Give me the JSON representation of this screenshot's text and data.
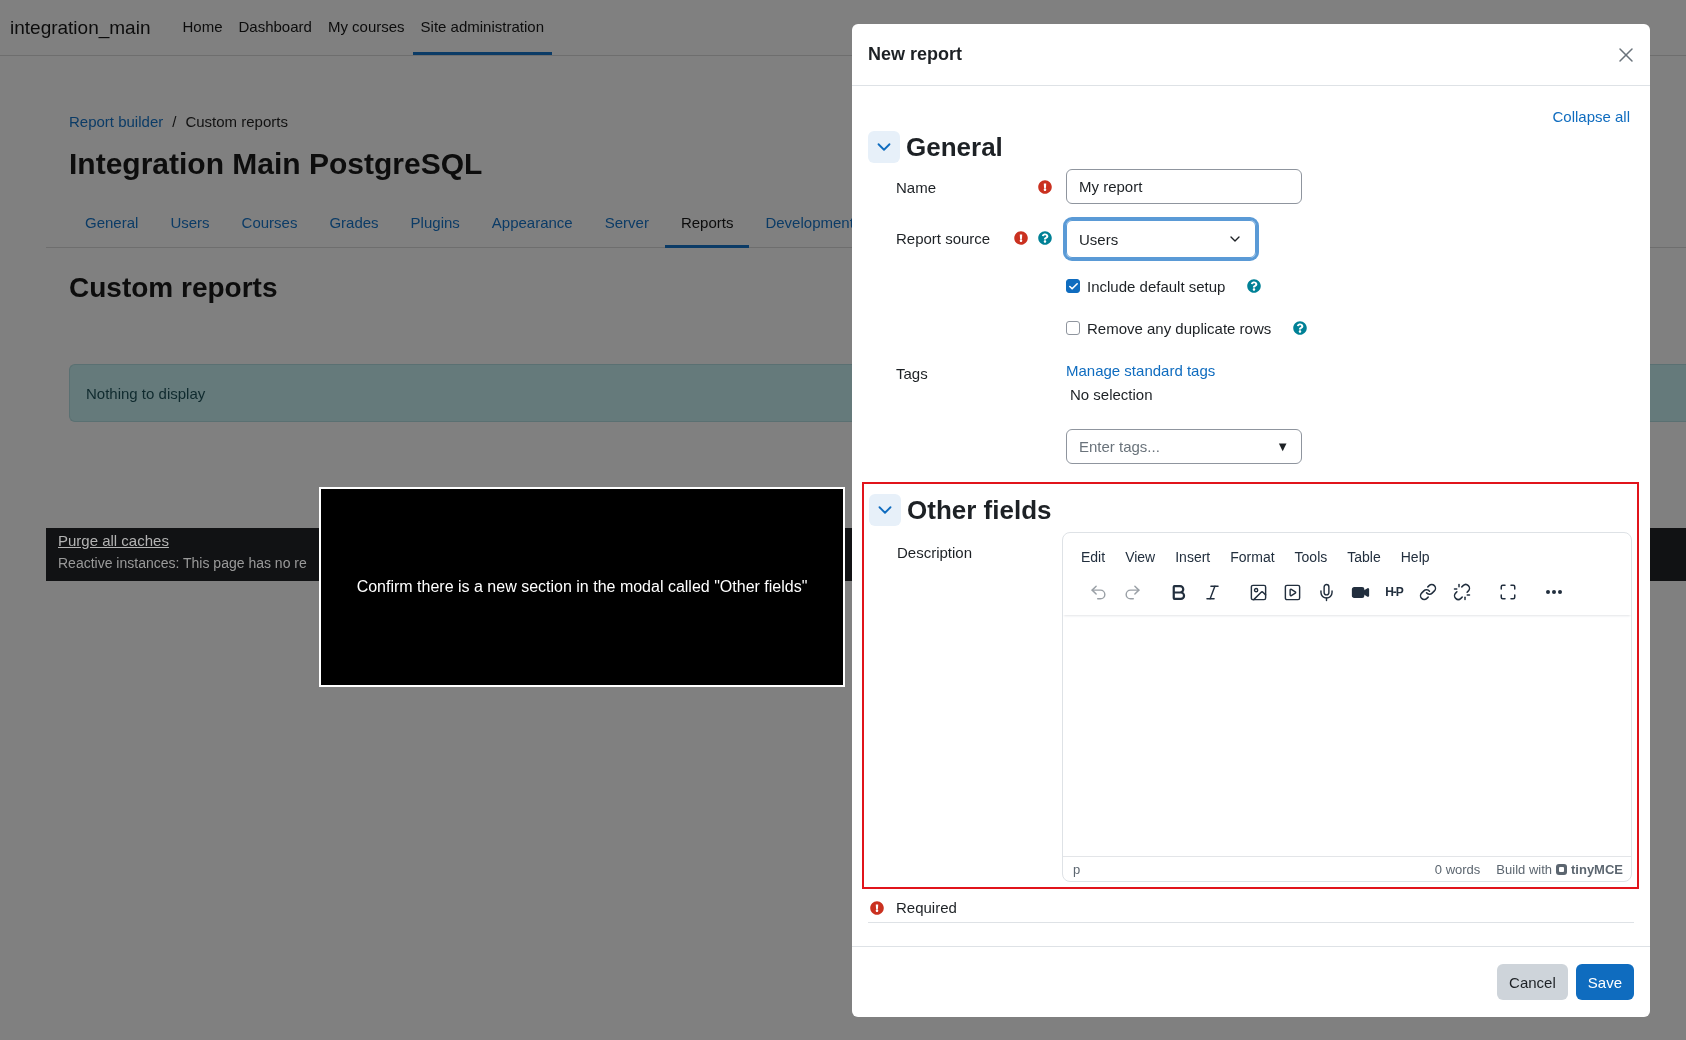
{
  "navbar": {
    "brand": "integration_main",
    "items": [
      {
        "label": "Home",
        "selected": false
      },
      {
        "label": "Dashboard",
        "selected": false
      },
      {
        "label": "My courses",
        "selected": false
      },
      {
        "label": "Site administration",
        "selected": true
      }
    ]
  },
  "breadcrumb": {
    "link": "Report builder",
    "separator": "/",
    "current": "Custom reports"
  },
  "page_title": "Integration Main PostgreSQL",
  "tabs": [
    {
      "label": "General",
      "selected": false
    },
    {
      "label": "Users",
      "selected": false
    },
    {
      "label": "Courses",
      "selected": false
    },
    {
      "label": "Grades",
      "selected": false
    },
    {
      "label": "Plugins",
      "selected": false
    },
    {
      "label": "Appearance",
      "selected": false
    },
    {
      "label": "Server",
      "selected": false
    },
    {
      "label": "Reports",
      "selected": true
    },
    {
      "label": "Development",
      "selected": false
    }
  ],
  "heading": "Custom reports",
  "alert": "Nothing to display",
  "footer": {
    "link": "Purge all caches",
    "text": "Reactive instances: This page has no re"
  },
  "annotation": {
    "text": "Confirm there is a new section in the modal called \"Other fields\""
  },
  "modal": {
    "title": "New report",
    "collapse_link": "Collapse all",
    "general": {
      "title": "General",
      "expanded": true,
      "name": {
        "label": "Name",
        "required": true,
        "value": "My report"
      },
      "source": {
        "label": "Report source",
        "required": true,
        "help": true,
        "value": "Users",
        "focused": true
      },
      "checkboxes": [
        {
          "label": "Include default setup",
          "checked": true
        },
        {
          "label": "Remove any duplicate rows",
          "checked": false
        }
      ],
      "tags": {
        "label": "Tags",
        "manage_link": "Manage standard tags",
        "selection": "No selection",
        "placeholder": "Enter tags...",
        "caret": "▼"
      }
    },
    "other": {
      "title": "Other fields",
      "expanded": true,
      "highlighted": true,
      "description": {
        "label": "Description",
        "menu": [
          "Edit",
          "View",
          "Insert",
          "Format",
          "Tools",
          "Table",
          "Help"
        ],
        "h5p_label": "H-P",
        "status_path": "p",
        "word_count": "0 words",
        "branding": "Build with",
        "brand_name": "tinyMCE"
      }
    },
    "required_note": "Required",
    "buttons": [
      {
        "label": "Cancel",
        "kind": "secondary"
      },
      {
        "label": "Save",
        "kind": "primary"
      }
    ]
  }
}
